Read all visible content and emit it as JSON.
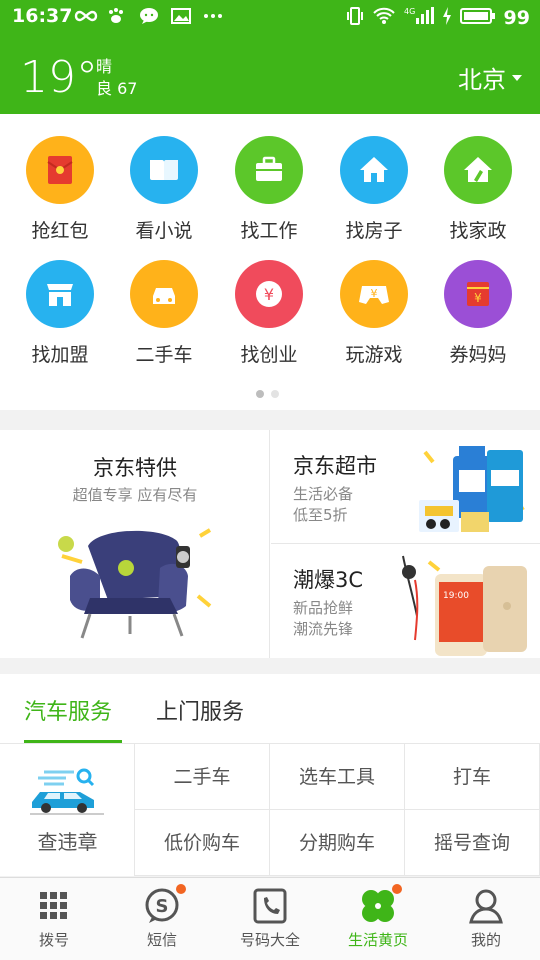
{
  "status_bar": {
    "time": "16:37",
    "battery": "99"
  },
  "header": {
    "temperature": "19°",
    "condition": "晴",
    "air_quality": "良 67",
    "city": "北京"
  },
  "grid": [
    {
      "label": "抢红包",
      "color": "#ffb21a",
      "icon": "red-envelope-icon"
    },
    {
      "label": "看小说",
      "color": "#27b2ef",
      "icon": "book-icon"
    },
    {
      "label": "找工作",
      "color": "#5cc72a",
      "icon": "briefcase-icon"
    },
    {
      "label": "找房子",
      "color": "#27b2ef",
      "icon": "house-icon"
    },
    {
      "label": "找家政",
      "color": "#5cc72a",
      "icon": "broom-house-icon"
    },
    {
      "label": "找加盟",
      "color": "#27b2ef",
      "icon": "shop-icon"
    },
    {
      "label": "二手车",
      "color": "#ffb21a",
      "icon": "car-icon"
    },
    {
      "label": "找创业",
      "color": "#f04b5c",
      "icon": "money-icon"
    },
    {
      "label": "玩游戏",
      "color": "#ffb21a",
      "icon": "gamepad-icon"
    },
    {
      "label": "券妈妈",
      "color": "#9b4fd6",
      "icon": "coupon-icon"
    }
  ],
  "promo": {
    "jd_special": {
      "title": "京东特供",
      "subtitle": "超值专享  应有尽有"
    },
    "jd_market": {
      "title": "京东超市",
      "line1": "生活必备",
      "line2": "低至5折"
    },
    "trend_3c": {
      "title": "潮爆3C",
      "line1": "新品抢鲜",
      "line2": "潮流先锋"
    }
  },
  "tabs": [
    {
      "label": "汽车服务"
    },
    {
      "label": "上门服务"
    }
  ],
  "services": {
    "main": "查违章",
    "cells": [
      "二手车",
      "选车工具",
      "打车",
      "低价购车",
      "分期购车",
      "摇号查询"
    ]
  },
  "bottom_nav": [
    {
      "label": "拨号",
      "icon": "dialpad-icon"
    },
    {
      "label": "短信",
      "icon": "message-icon"
    },
    {
      "label": "号码大全",
      "icon": "phonebook-icon"
    },
    {
      "label": "生活黄页",
      "icon": "clover-icon"
    },
    {
      "label": "我的",
      "icon": "profile-icon"
    }
  ],
  "colors": {
    "brand_green": "#3fb518",
    "badge_orange": "#f26522"
  }
}
